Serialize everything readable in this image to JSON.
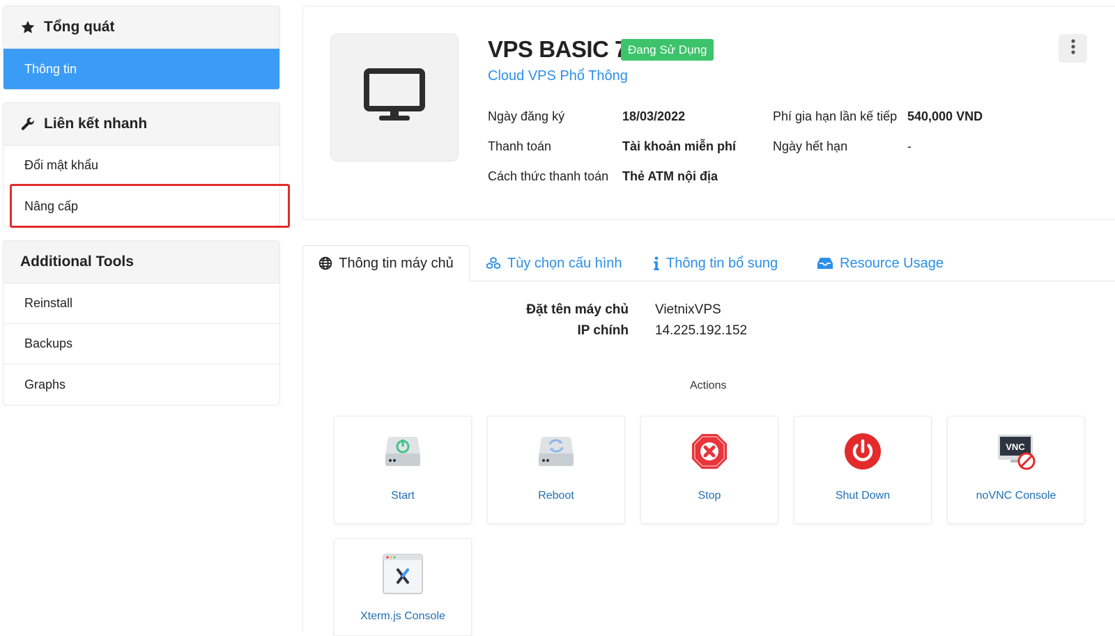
{
  "sidebar": {
    "overview": {
      "title": "Tổng quát",
      "items": [
        {
          "label": "Thông tin"
        }
      ]
    },
    "quicklinks": {
      "title": "Liên kết nhanh",
      "items": [
        {
          "label": "Đổi mật khẩu"
        },
        {
          "label": "Nâng cấp"
        }
      ]
    },
    "tools": {
      "title": "Additional Tools",
      "items": [
        {
          "label": "Reinstall"
        },
        {
          "label": "Backups"
        },
        {
          "label": "Graphs"
        }
      ]
    }
  },
  "product": {
    "name": "VPS BASIC 7",
    "status": "Đang Sử Dụng",
    "group": "Cloud VPS Phổ Thông",
    "details": {
      "reg_date_label": "Ngày đăng ký",
      "reg_date": "18/03/2022",
      "payment_label": "Thanh toán",
      "payment": "Tài khoản miễn phí",
      "method_label": "Cách thức thanh toán",
      "method": "Thẻ ATM nội địa",
      "renew_label": "Phí gia hạn lần kế tiếp",
      "renew": "540,000 VND",
      "expiry_label": "Ngày hết hạn",
      "expiry": "-"
    }
  },
  "tabs": [
    {
      "label": "Thông tin máy chủ",
      "icon": "globe-icon"
    },
    {
      "label": "Tùy chọn cấu hình",
      "icon": "cubes-icon"
    },
    {
      "label": "Thông tin bổ sung",
      "icon": "info-icon"
    },
    {
      "label": "Resource Usage",
      "icon": "inbox-icon"
    }
  ],
  "server": {
    "hostname_label": "Đặt tên máy chủ",
    "hostname": "VietnixVPS",
    "ip_label": "IP chính",
    "ip": "14.225.192.152"
  },
  "actions": {
    "title": "Actions",
    "items": [
      {
        "label": "Start",
        "icon": "server-power-icon"
      },
      {
        "label": "Reboot",
        "icon": "server-refresh-icon"
      },
      {
        "label": "Stop",
        "icon": "stop-octagon-icon"
      },
      {
        "label": "Shut Down",
        "icon": "power-button-icon"
      },
      {
        "label": "noVNC Console",
        "icon": "vnc-console-icon",
        "icon_text": "VNC"
      },
      {
        "label": "Xterm.js Console",
        "icon": "xterm-console-icon"
      }
    ]
  },
  "colors": {
    "accent_blue": "#3b9cf6",
    "link_blue": "#2b8fe8",
    "status_green": "#3cc36b",
    "danger_red": "#e02b2b"
  }
}
